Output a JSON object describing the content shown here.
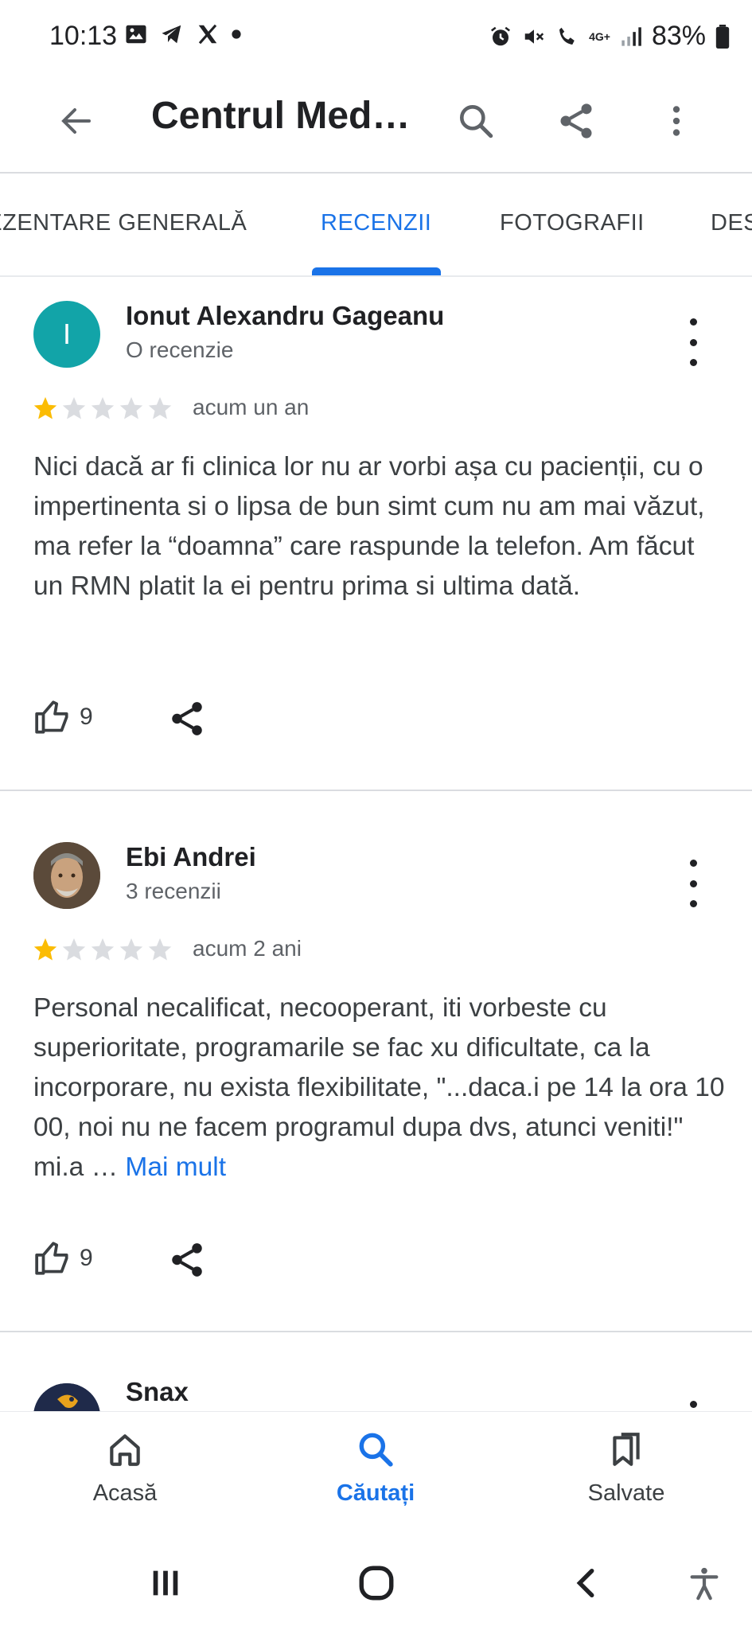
{
  "status_bar": {
    "time": "10:13",
    "battery": "83%",
    "network": "4G+"
  },
  "app_bar": {
    "title": "Centrul Med…"
  },
  "tabs": [
    {
      "label": "PREZENTARE GENERALĂ",
      "active": false
    },
    {
      "label": "RECENZII",
      "active": true
    },
    {
      "label": "FOTOGRAFII",
      "active": false
    },
    {
      "label": "DESPRE",
      "active": false
    }
  ],
  "reviews": [
    {
      "author": "Ionut Alexandru Gageanu",
      "avatar_letter": "I",
      "review_count": "O recenzie",
      "rating": 1,
      "max_rating": 5,
      "age": "acum un an",
      "text": "Nici dacă ar fi clinica lor nu ar vorbi așa cu pacienții, cu o impertinenta si o lipsa de bun simt cum nu am mai văzut, ma refer la “doamna” care raspunde la telefon. Am făcut un RMN platit la ei pentru prima si ultima dată.",
      "more": "",
      "likes": "9"
    },
    {
      "author": "Ebi Andrei",
      "avatar_letter": "",
      "review_count": "3 recenzii",
      "rating": 1,
      "max_rating": 5,
      "age": "acum 2 ani",
      "text": "Personal necalificat, necooperant, iti vorbeste cu superioritate, programarile se fac xu dificultate, ca la incorporare, nu exista flexibilitate, \"...daca.i pe 14 la ora 10 00, noi nu ne facem programul dupa dvs, atunci veniti!\" mi.a …",
      "more": "Mai mult",
      "likes": "9"
    },
    {
      "author": "Snax"
    }
  ],
  "bottom_nav": [
    {
      "label": "Acasă",
      "icon": "home-icon",
      "active": false
    },
    {
      "label": "Căutați",
      "icon": "search-icon",
      "active": true
    },
    {
      "label": "Salvate",
      "icon": "bookmarks-icon",
      "active": false
    }
  ],
  "colors": {
    "accent": "#1a73e8",
    "star_filled": "#fbbc04",
    "star_empty": "#dadce0",
    "avatar_teal": "#12a4a8"
  }
}
